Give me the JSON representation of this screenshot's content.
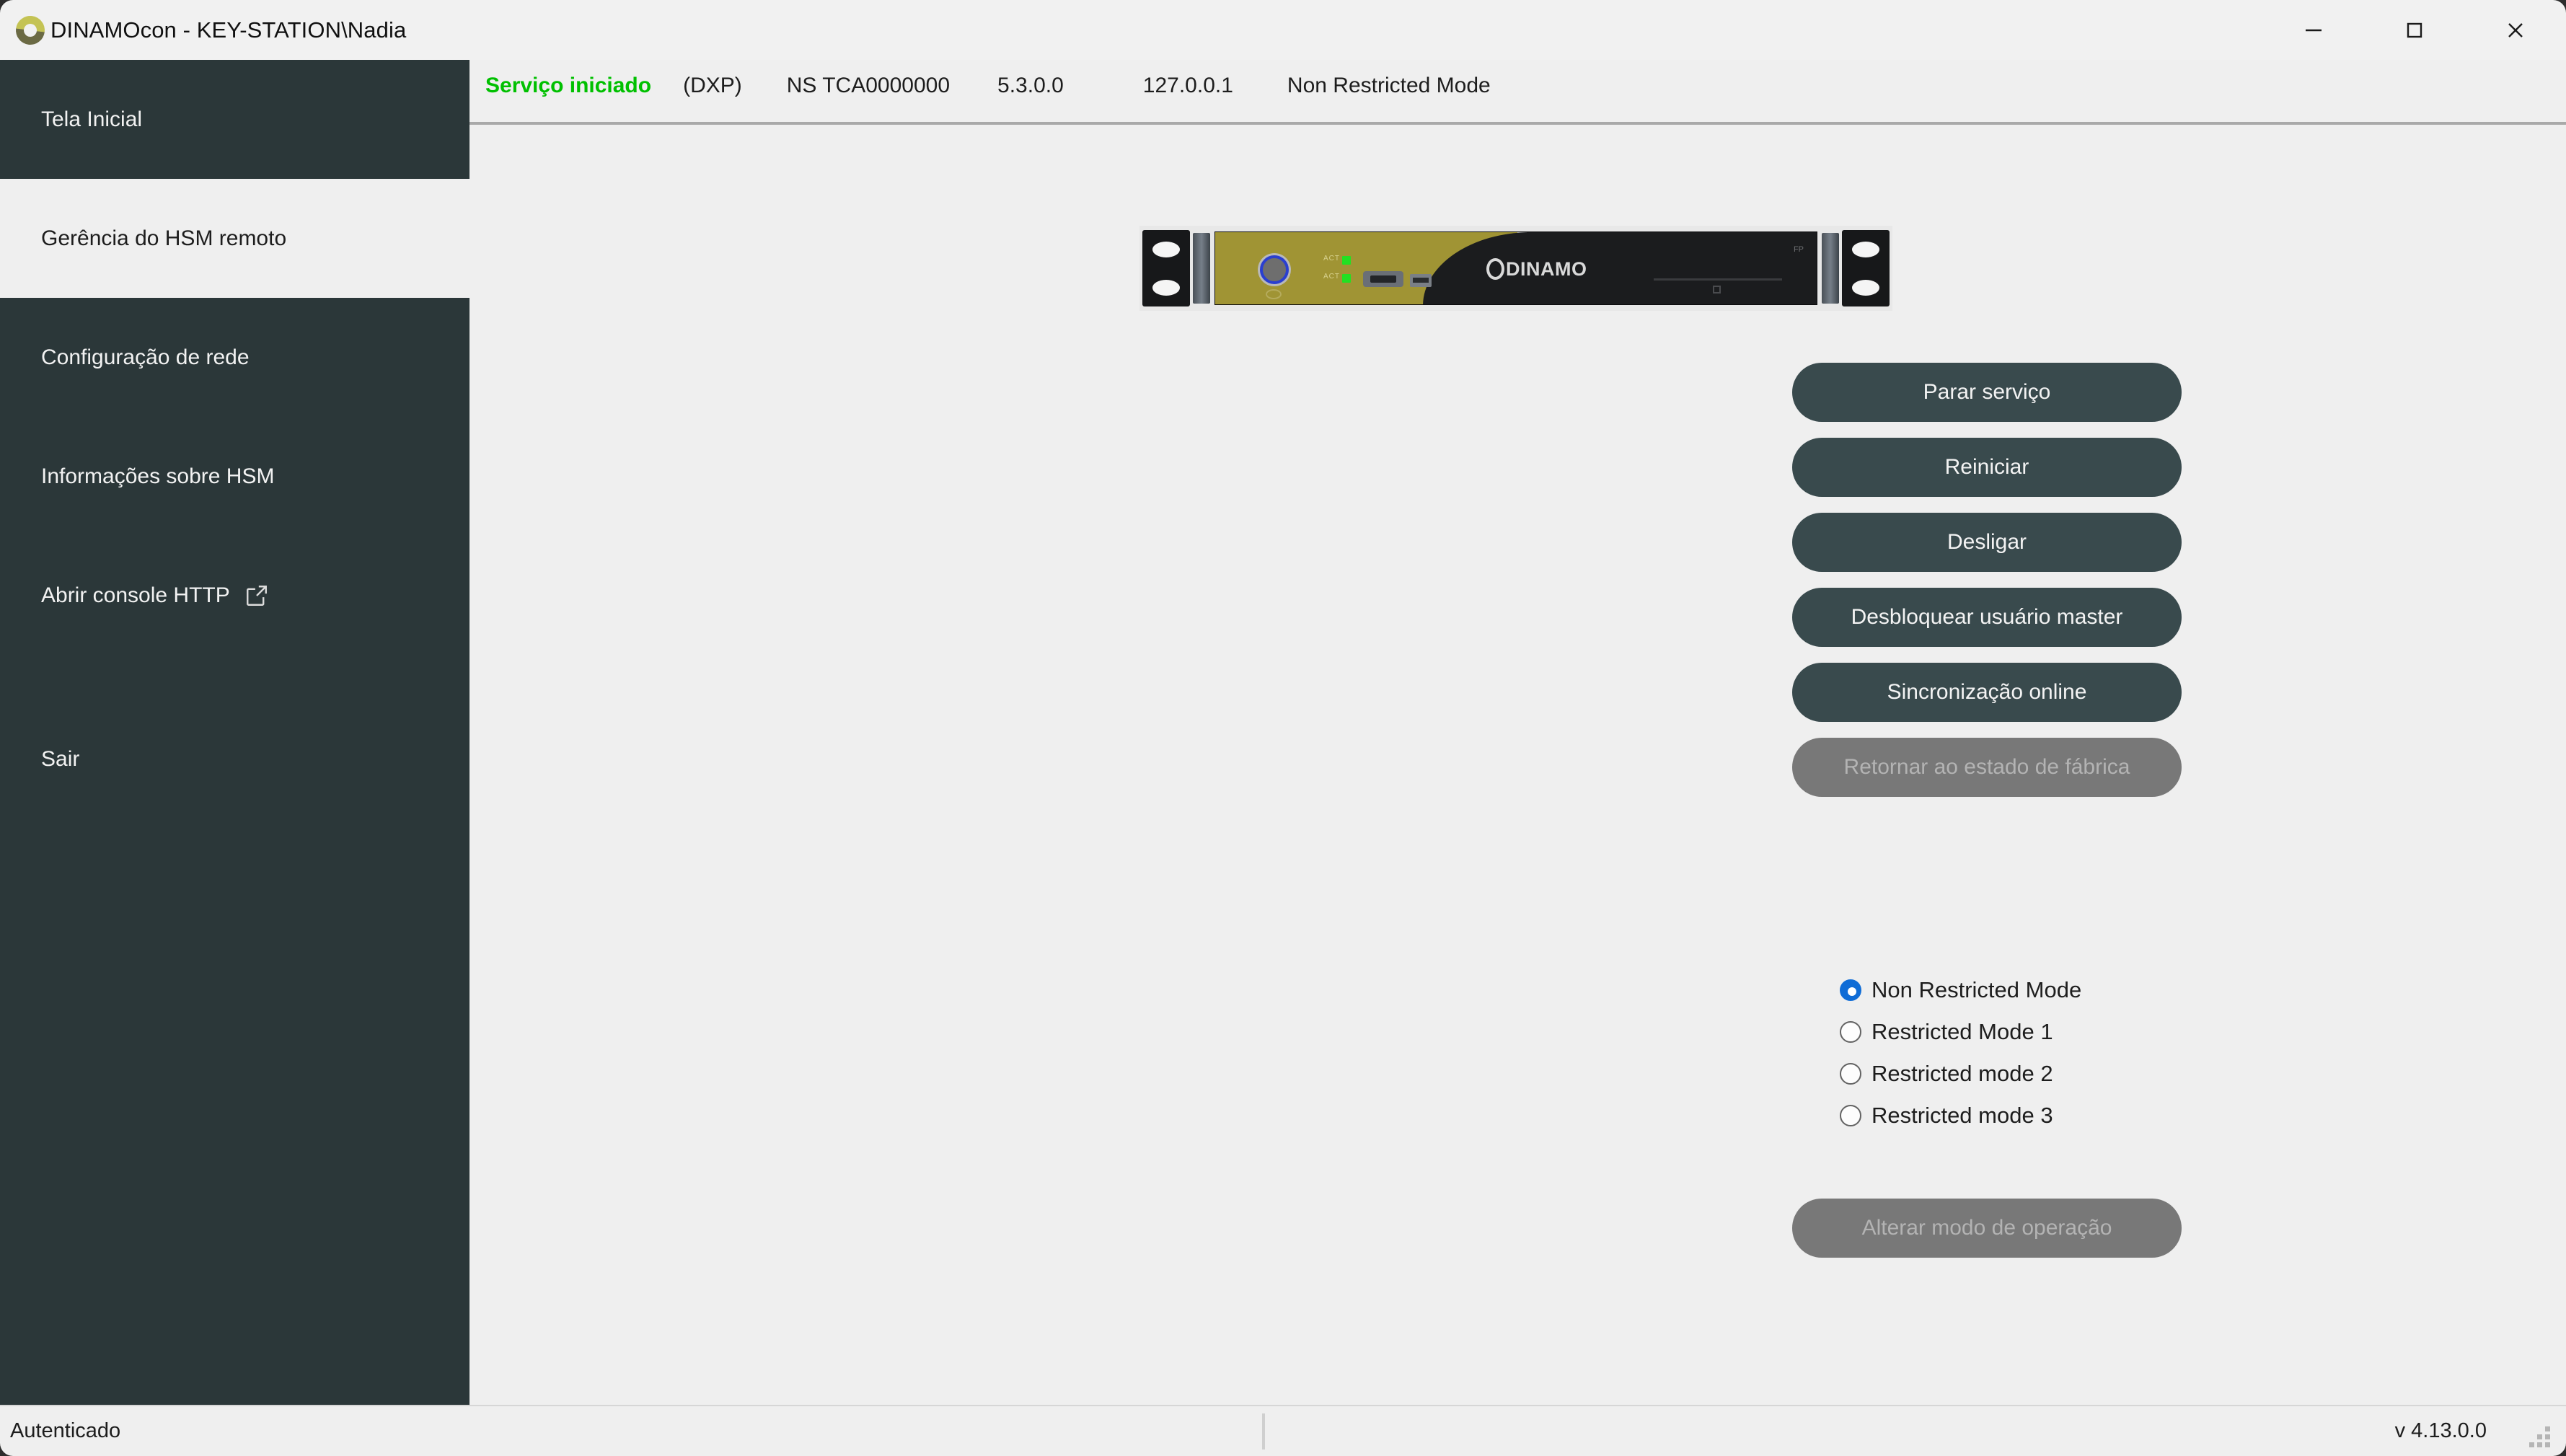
{
  "window": {
    "title": "DINAMOcon - KEY-STATION\\Nadia",
    "logo_icon": "dinamo-ring-logo",
    "minimize_label": "Minimizar",
    "maximize_label": "Maximizar",
    "close_label": "Fechar",
    "accent_olive": "#a09434",
    "sidebar_bg": "#2b3739",
    "panel_bg": "#efefef"
  },
  "sidebar": {
    "items": [
      {
        "label": "Tela Inicial",
        "selected": false,
        "icon": null
      },
      {
        "label": "Gerência do HSM remoto",
        "selected": true,
        "icon": null
      },
      {
        "label": "Configuração de rede",
        "selected": false,
        "icon": null
      },
      {
        "label": "Informações sobre HSM",
        "selected": false,
        "icon": null
      },
      {
        "label": "Abrir console HTTP",
        "selected": false,
        "icon": "external-link-icon"
      },
      {
        "label": "Sair",
        "selected": false,
        "icon": null
      }
    ]
  },
  "header": {
    "service_status": "Serviço iniciado",
    "service_status_color": "#00c000",
    "protocol": "(DXP)",
    "serial": "NS TCA0000000",
    "version": "5.3.0.0",
    "address": "127.0.0.1",
    "mode": "Non Restricted Mode"
  },
  "device": {
    "brand": "DINAMO",
    "led_1_label": "ACT",
    "led_2_label": "ACT",
    "tick_label": "FP"
  },
  "actions": [
    {
      "label": "Parar serviço",
      "disabled": false
    },
    {
      "label": "Reiniciar",
      "disabled": false
    },
    {
      "label": "Desligar",
      "disabled": false
    },
    {
      "label": "Desbloquear usuário master",
      "disabled": false
    },
    {
      "label": "Sincronização online",
      "disabled": false
    },
    {
      "label": "Retornar ao estado de fábrica",
      "disabled": true
    }
  ],
  "modes": {
    "options": [
      {
        "label": "Non Restricted Mode",
        "selected": true
      },
      {
        "label": "Restricted Mode 1",
        "selected": false
      },
      {
        "label": "Restricted mode 2",
        "selected": false
      },
      {
        "label": "Restricted mode 3",
        "selected": false
      }
    ],
    "apply_label": "Alterar modo de operação",
    "apply_disabled": true,
    "selected_color": "#0f6cd6"
  },
  "statusbar": {
    "left_text": "Autenticado",
    "version_text": "v 4.13.0.0",
    "grip_icon": "resize-grip-icon"
  }
}
